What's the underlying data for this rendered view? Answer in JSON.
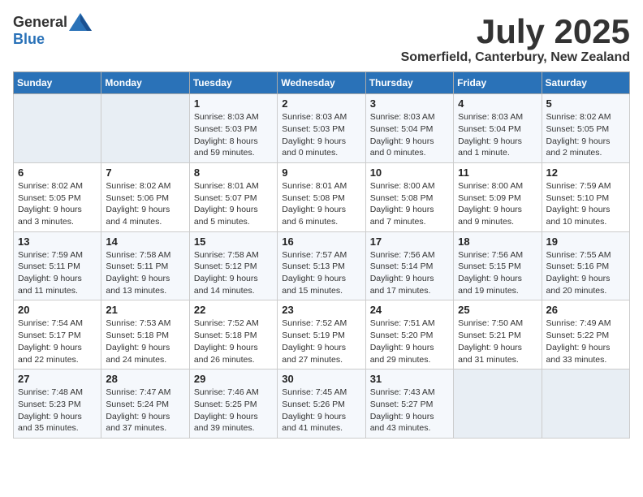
{
  "logo": {
    "general": "General",
    "blue": "Blue"
  },
  "title": {
    "month_year": "July 2025",
    "location": "Somerfield, Canterbury, New Zealand"
  },
  "days_of_week": [
    "Sunday",
    "Monday",
    "Tuesday",
    "Wednesday",
    "Thursday",
    "Friday",
    "Saturday"
  ],
  "weeks": [
    [
      {
        "day": "",
        "details": ""
      },
      {
        "day": "",
        "details": ""
      },
      {
        "day": "1",
        "details": "Sunrise: 8:03 AM\nSunset: 5:03 PM\nDaylight: 8 hours and 59 minutes."
      },
      {
        "day": "2",
        "details": "Sunrise: 8:03 AM\nSunset: 5:03 PM\nDaylight: 9 hours and 0 minutes."
      },
      {
        "day": "3",
        "details": "Sunrise: 8:03 AM\nSunset: 5:04 PM\nDaylight: 9 hours and 0 minutes."
      },
      {
        "day": "4",
        "details": "Sunrise: 8:03 AM\nSunset: 5:04 PM\nDaylight: 9 hours and 1 minute."
      },
      {
        "day": "5",
        "details": "Sunrise: 8:02 AM\nSunset: 5:05 PM\nDaylight: 9 hours and 2 minutes."
      }
    ],
    [
      {
        "day": "6",
        "details": "Sunrise: 8:02 AM\nSunset: 5:05 PM\nDaylight: 9 hours and 3 minutes."
      },
      {
        "day": "7",
        "details": "Sunrise: 8:02 AM\nSunset: 5:06 PM\nDaylight: 9 hours and 4 minutes."
      },
      {
        "day": "8",
        "details": "Sunrise: 8:01 AM\nSunset: 5:07 PM\nDaylight: 9 hours and 5 minutes."
      },
      {
        "day": "9",
        "details": "Sunrise: 8:01 AM\nSunset: 5:08 PM\nDaylight: 9 hours and 6 minutes."
      },
      {
        "day": "10",
        "details": "Sunrise: 8:00 AM\nSunset: 5:08 PM\nDaylight: 9 hours and 7 minutes."
      },
      {
        "day": "11",
        "details": "Sunrise: 8:00 AM\nSunset: 5:09 PM\nDaylight: 9 hours and 9 minutes."
      },
      {
        "day": "12",
        "details": "Sunrise: 7:59 AM\nSunset: 5:10 PM\nDaylight: 9 hours and 10 minutes."
      }
    ],
    [
      {
        "day": "13",
        "details": "Sunrise: 7:59 AM\nSunset: 5:11 PM\nDaylight: 9 hours and 11 minutes."
      },
      {
        "day": "14",
        "details": "Sunrise: 7:58 AM\nSunset: 5:11 PM\nDaylight: 9 hours and 13 minutes."
      },
      {
        "day": "15",
        "details": "Sunrise: 7:58 AM\nSunset: 5:12 PM\nDaylight: 9 hours and 14 minutes."
      },
      {
        "day": "16",
        "details": "Sunrise: 7:57 AM\nSunset: 5:13 PM\nDaylight: 9 hours and 15 minutes."
      },
      {
        "day": "17",
        "details": "Sunrise: 7:56 AM\nSunset: 5:14 PM\nDaylight: 9 hours and 17 minutes."
      },
      {
        "day": "18",
        "details": "Sunrise: 7:56 AM\nSunset: 5:15 PM\nDaylight: 9 hours and 19 minutes."
      },
      {
        "day": "19",
        "details": "Sunrise: 7:55 AM\nSunset: 5:16 PM\nDaylight: 9 hours and 20 minutes."
      }
    ],
    [
      {
        "day": "20",
        "details": "Sunrise: 7:54 AM\nSunset: 5:17 PM\nDaylight: 9 hours and 22 minutes."
      },
      {
        "day": "21",
        "details": "Sunrise: 7:53 AM\nSunset: 5:18 PM\nDaylight: 9 hours and 24 minutes."
      },
      {
        "day": "22",
        "details": "Sunrise: 7:52 AM\nSunset: 5:18 PM\nDaylight: 9 hours and 26 minutes."
      },
      {
        "day": "23",
        "details": "Sunrise: 7:52 AM\nSunset: 5:19 PM\nDaylight: 9 hours and 27 minutes."
      },
      {
        "day": "24",
        "details": "Sunrise: 7:51 AM\nSunset: 5:20 PM\nDaylight: 9 hours and 29 minutes."
      },
      {
        "day": "25",
        "details": "Sunrise: 7:50 AM\nSunset: 5:21 PM\nDaylight: 9 hours and 31 minutes."
      },
      {
        "day": "26",
        "details": "Sunrise: 7:49 AM\nSunset: 5:22 PM\nDaylight: 9 hours and 33 minutes."
      }
    ],
    [
      {
        "day": "27",
        "details": "Sunrise: 7:48 AM\nSunset: 5:23 PM\nDaylight: 9 hours and 35 minutes."
      },
      {
        "day": "28",
        "details": "Sunrise: 7:47 AM\nSunset: 5:24 PM\nDaylight: 9 hours and 37 minutes."
      },
      {
        "day": "29",
        "details": "Sunrise: 7:46 AM\nSunset: 5:25 PM\nDaylight: 9 hours and 39 minutes."
      },
      {
        "day": "30",
        "details": "Sunrise: 7:45 AM\nSunset: 5:26 PM\nDaylight: 9 hours and 41 minutes."
      },
      {
        "day": "31",
        "details": "Sunrise: 7:43 AM\nSunset: 5:27 PM\nDaylight: 9 hours and 43 minutes."
      },
      {
        "day": "",
        "details": ""
      },
      {
        "day": "",
        "details": ""
      }
    ]
  ]
}
